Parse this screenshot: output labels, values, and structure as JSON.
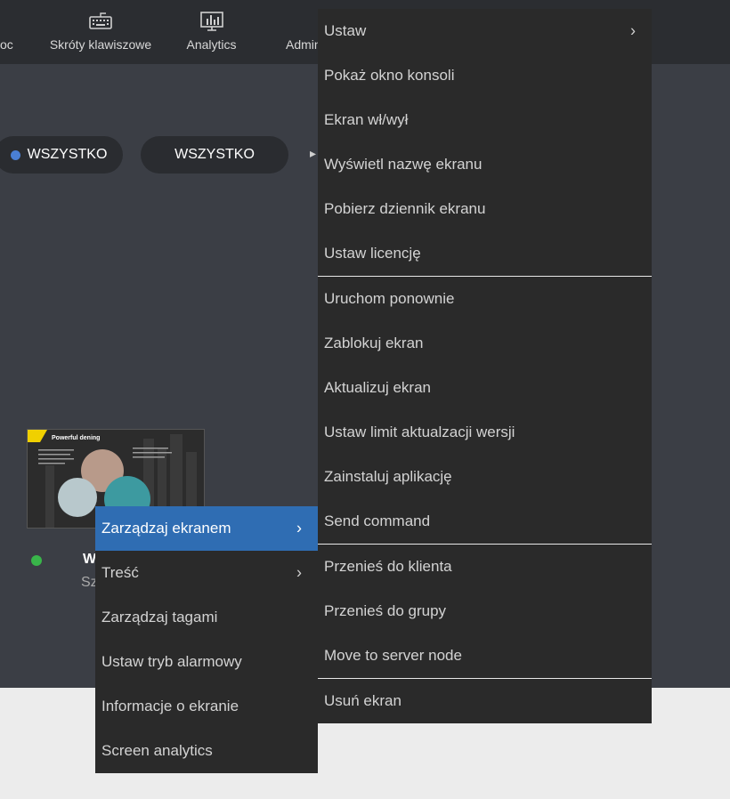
{
  "topnav": {
    "items": [
      {
        "label": "oc"
      },
      {
        "label": "Skróty klawiszowe",
        "icon": "keyboard-icon"
      },
      {
        "label": "Analytics",
        "icon": "analytics-icon"
      },
      {
        "label": "Admin",
        "icon": "gear-icon"
      }
    ]
  },
  "filters": {
    "pill1": "WSZYSTKO",
    "pill2": "WSZYSTKO",
    "pill1_dot_color": "#4a7fd4"
  },
  "screen": {
    "thumb_title": "Powerful dening",
    "name": "W",
    "sub": "Sz",
    "status_color": "#39b54a"
  },
  "context_menu": {
    "items": [
      {
        "label": "Zarządzaj ekranem",
        "submenu": true,
        "active": true
      },
      {
        "label": "Treść",
        "submenu": true
      },
      {
        "label": "Zarządzaj tagami"
      },
      {
        "label": "Ustaw tryb alarmowy"
      },
      {
        "label": "Informacje o ekranie"
      },
      {
        "label": "Screen analytics"
      }
    ]
  },
  "submenu": {
    "items": [
      {
        "label": "Ustaw",
        "submenu": true
      },
      {
        "label": "Pokaż okno konsoli"
      },
      {
        "label": "Ekran wł/wył"
      },
      {
        "label": "Wyświetl nazwę ekranu"
      },
      {
        "label": "Pobierz dziennik ekranu"
      },
      {
        "label": "Ustaw licencję"
      },
      {
        "label": "Uruchom ponownie"
      },
      {
        "label": "Zablokuj ekran"
      },
      {
        "label": "Aktualizuj ekran"
      },
      {
        "label": "Ustaw limit aktualzacji wersji"
      },
      {
        "label": "Zainstaluj aplikację"
      },
      {
        "label": "Send command"
      },
      {
        "label": "Przenieś do klienta"
      },
      {
        "label": "Przenieś do grupy"
      },
      {
        "label": "Move to server node"
      },
      {
        "label": "Usuń ekran"
      }
    ]
  },
  "colors": {
    "topbar": "#2b2d31",
    "content": "#3b3e45",
    "menu": "#2a2a2a",
    "active": "#2f6db3"
  }
}
